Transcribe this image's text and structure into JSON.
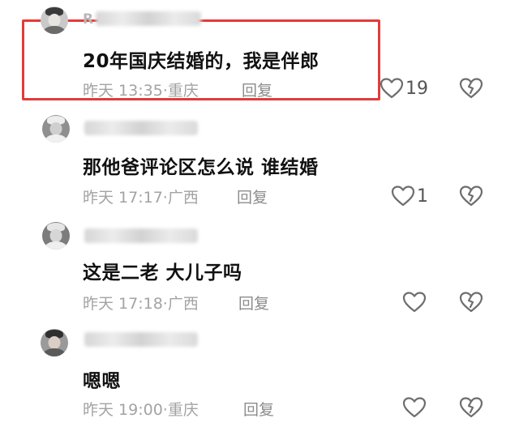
{
  "comments": [
    {
      "name_visible": "R",
      "text": "20年国庆结婚的，我是伴郎",
      "time": "昨天 13:35",
      "location": "重庆",
      "reply_label": "回复",
      "like_count": "19"
    },
    {
      "name_visible": "",
      "text": "那他爸评论区怎么说 谁结婚",
      "time": "昨天 17:17",
      "location": "广西",
      "reply_label": "回复",
      "like_count": "1"
    },
    {
      "name_visible": "",
      "text": "这是二老 大儿子吗",
      "time": "昨天 17:18",
      "location": "广西",
      "reply_label": "回复",
      "like_count": ""
    },
    {
      "name_visible": "",
      "text": "嗯嗯",
      "time": "昨天 19:00",
      "location": "重庆",
      "reply_label": "回复",
      "like_count": ""
    }
  ],
  "separator": "·",
  "icons": {
    "like": "heart-outline-icon",
    "dislike": "broken-heart-icon"
  },
  "colors": {
    "highlight_border": "#e23b3b",
    "text": "#111111",
    "meta": "#a3a3a3"
  }
}
